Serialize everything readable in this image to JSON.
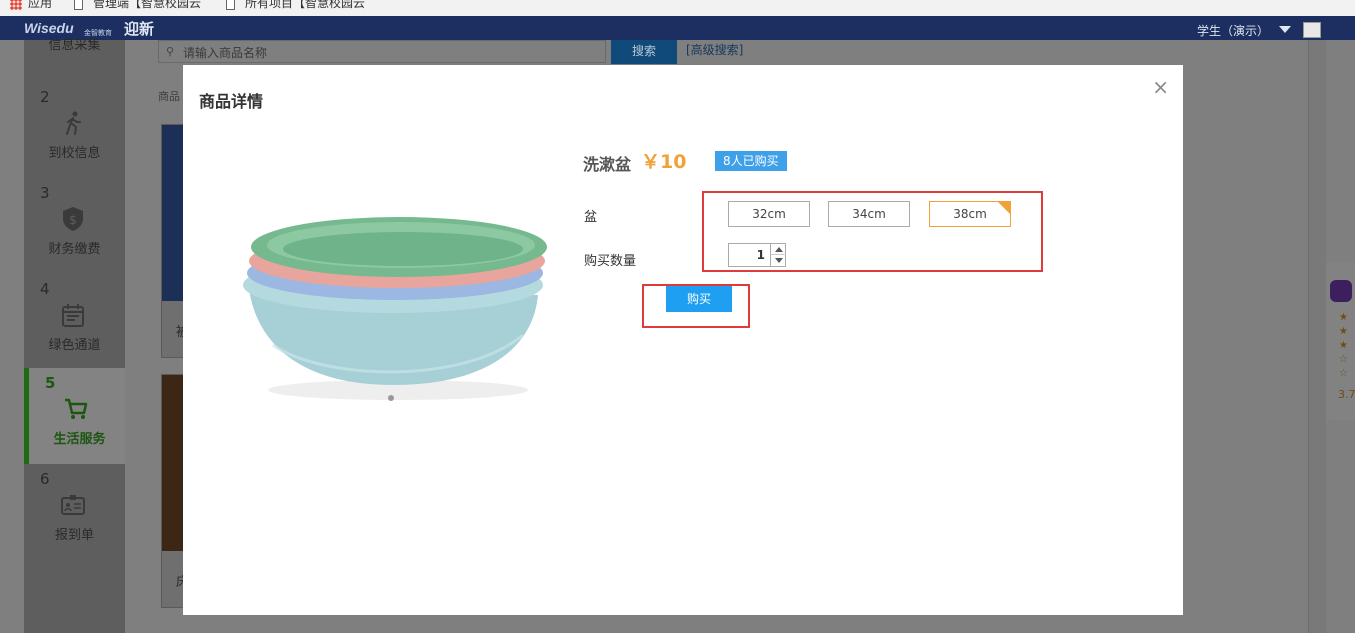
{
  "browser": {
    "bookmarks": [
      {
        "label": "应用"
      },
      {
        "label": "管理端【智慧校园云"
      },
      {
        "label": "所有项目【智慧校园云"
      }
    ]
  },
  "header": {
    "logo": "Wisedu",
    "logo_sub": "金智教育",
    "app_title": "迎新",
    "user_role": "学生（演示）"
  },
  "sidebar": {
    "steps": [
      {
        "num": "",
        "label": "信息采集",
        "icon": "form-icon"
      },
      {
        "num": "2",
        "label": "到校信息",
        "icon": "walking-person-icon"
      },
      {
        "num": "3",
        "label": "财务缴费",
        "icon": "dollar-shield-icon"
      },
      {
        "num": "4",
        "label": "绿色通道",
        "icon": "calendar-icon"
      },
      {
        "num": "5",
        "label": "生活服务",
        "icon": "shopping-cart-icon",
        "active": true
      },
      {
        "num": "6",
        "label": "报到单",
        "icon": "id-card-icon"
      }
    ]
  },
  "search": {
    "placeholder": "请输入商品名称",
    "button_label": "搜索",
    "advanced_label": "[高级搜索]"
  },
  "breadcrumb": "商品",
  "cards": [
    {
      "title_fragment": "被"
    },
    {
      "title_fragment": "床"
    }
  ],
  "right_widget": {
    "rating": "3.7"
  },
  "modal": {
    "title": "商品详情",
    "close_label": "×",
    "product": {
      "name": "洗漱盆",
      "price": "￥10",
      "sold_badge": "8人已购买",
      "option_label": "盆",
      "options": [
        "32cm",
        "34cm",
        "38cm"
      ],
      "selected_option": "38cm",
      "quantity_label": "购买数量",
      "quantity": "1",
      "buy_label": "购买",
      "image_colors": [
        "#6fb38a",
        "#e89a93",
        "#8aaedb",
        "#9fcfd8"
      ]
    }
  },
  "colors": {
    "header_bg": "#1c2f60",
    "price": "#f0a23a",
    "badge": "#3ea0e9",
    "buy_button": "#1e9ff2",
    "highlight": "#e03b3b",
    "active_step": "#1f6b14"
  }
}
